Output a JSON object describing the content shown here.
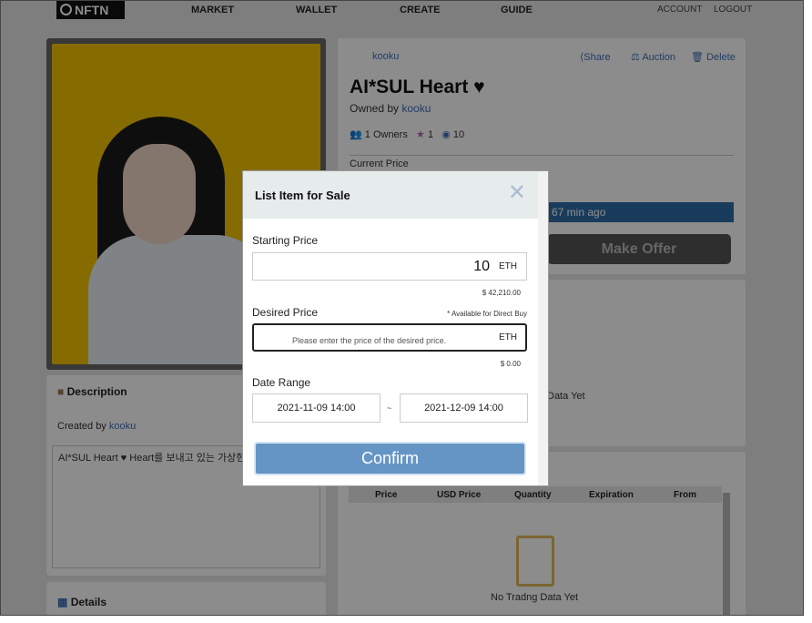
{
  "nav": {
    "logo": "NFTN",
    "items": [
      "MARKET",
      "WALLET",
      "CREATE",
      "GUIDE"
    ],
    "account": "ACCOUNT",
    "logout": "LOGOUT"
  },
  "item": {
    "creator": "kooku",
    "share": "Share",
    "auction": "Auction",
    "delete": "Delete",
    "title": "AI*SUL Heart ♥",
    "owned_by": "Owned by",
    "owner": "kooku",
    "owners": "1 Owners",
    "favorites": "1",
    "views": "10",
    "current_price": "Current Price",
    "updated": "67 min ago",
    "make_offer": "Make Offer",
    "chart_empty": "Data Yet"
  },
  "description": {
    "title": "Description",
    "created_by": "Created by",
    "creator": "kooku",
    "text": "AI*SUL Heart ♥ Heart를 보내고 있는 가상현실"
  },
  "details": {
    "title": "Details"
  },
  "trading": {
    "columns": [
      "Price",
      "USD Price",
      "Quantity",
      "Expiration",
      "From"
    ],
    "empty": "No Tradng Data Yet"
  },
  "modal": {
    "title": "List Item for Sale",
    "starting_label": "Starting Price",
    "starting_value": "10",
    "currency": "ETH",
    "starting_usd": "$ 42,210.00",
    "desired_label": "Desired Price",
    "desired_note": "* Available for Direct Buy",
    "desired_placeholder": "Please enter the price of the desired price.",
    "desired_usd": "$ 0.00",
    "date_label": "Date Range",
    "date_start": "2021-11-09 14:00",
    "date_sep": "~",
    "date_end": "2021-12-09 14:00",
    "confirm": "Confirm"
  },
  "colors": {
    "accent": "#6595c5",
    "link": "#3d6fb6",
    "progress": "#2f6da8"
  }
}
